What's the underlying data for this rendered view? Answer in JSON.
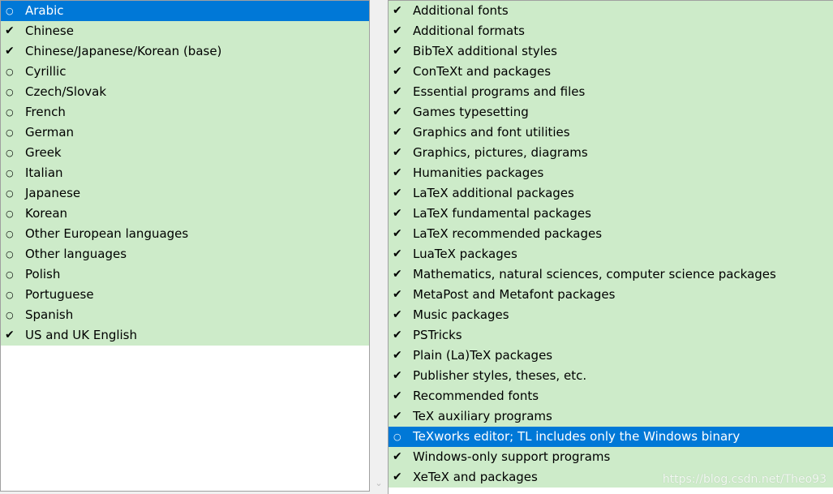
{
  "glyphs": {
    "checked": "✔",
    "unchecked": "○"
  },
  "colors": {
    "checked_row": "#cdebc9",
    "selected_row": "#0078d7",
    "selected_text": "#ffffff"
  },
  "left_list": {
    "name": "language-collections",
    "items": [
      {
        "label": "Arabic",
        "checked": false,
        "selected": true
      },
      {
        "label": "Chinese",
        "checked": true,
        "selected": false
      },
      {
        "label": "Chinese/Japanese/Korean (base)",
        "checked": true,
        "selected": false
      },
      {
        "label": "Cyrillic",
        "checked": false,
        "selected": false
      },
      {
        "label": "Czech/Slovak",
        "checked": false,
        "selected": false
      },
      {
        "label": "French",
        "checked": false,
        "selected": false
      },
      {
        "label": "German",
        "checked": false,
        "selected": false
      },
      {
        "label": "Greek",
        "checked": false,
        "selected": false
      },
      {
        "label": "Italian",
        "checked": false,
        "selected": false
      },
      {
        "label": "Japanese",
        "checked": false,
        "selected": false
      },
      {
        "label": "Korean",
        "checked": false,
        "selected": false
      },
      {
        "label": "Other European languages",
        "checked": false,
        "selected": false
      },
      {
        "label": "Other languages",
        "checked": false,
        "selected": false
      },
      {
        "label": "Polish",
        "checked": false,
        "selected": false
      },
      {
        "label": "Portuguese",
        "checked": false,
        "selected": false
      },
      {
        "label": "Spanish",
        "checked": false,
        "selected": false
      },
      {
        "label": "US and UK English",
        "checked": true,
        "selected": false
      }
    ]
  },
  "right_list": {
    "name": "other-collections",
    "items": [
      {
        "label": "Additional fonts",
        "checked": true,
        "selected": false
      },
      {
        "label": "Additional formats",
        "checked": true,
        "selected": false
      },
      {
        "label": "BibTeX additional styles",
        "checked": true,
        "selected": false
      },
      {
        "label": "ConTeXt and packages",
        "checked": true,
        "selected": false
      },
      {
        "label": "Essential programs and files",
        "checked": true,
        "selected": false
      },
      {
        "label": "Games typesetting",
        "checked": true,
        "selected": false
      },
      {
        "label": "Graphics and font utilities",
        "checked": true,
        "selected": false
      },
      {
        "label": "Graphics, pictures, diagrams",
        "checked": true,
        "selected": false
      },
      {
        "label": "Humanities packages",
        "checked": true,
        "selected": false
      },
      {
        "label": "LaTeX additional packages",
        "checked": true,
        "selected": false
      },
      {
        "label": "LaTeX fundamental packages",
        "checked": true,
        "selected": false
      },
      {
        "label": "LaTeX recommended packages",
        "checked": true,
        "selected": false
      },
      {
        "label": "LuaTeX packages",
        "checked": true,
        "selected": false
      },
      {
        "label": "Mathematics, natural sciences, computer science packages",
        "checked": true,
        "selected": false
      },
      {
        "label": "MetaPost and Metafont packages",
        "checked": true,
        "selected": false
      },
      {
        "label": "Music packages",
        "checked": true,
        "selected": false
      },
      {
        "label": "PSTricks",
        "checked": true,
        "selected": false
      },
      {
        "label": "Plain (La)TeX packages",
        "checked": true,
        "selected": false
      },
      {
        "label": "Publisher styles, theses, etc.",
        "checked": true,
        "selected": false
      },
      {
        "label": "Recommended fonts",
        "checked": true,
        "selected": false
      },
      {
        "label": "TeX auxiliary programs",
        "checked": true,
        "selected": false
      },
      {
        "label": "TeXworks editor; TL includes only the Windows binary",
        "checked": false,
        "selected": true
      },
      {
        "label": "Windows-only support programs",
        "checked": true,
        "selected": false
      },
      {
        "label": "XeTeX and packages",
        "checked": true,
        "selected": false
      }
    ]
  },
  "scroll_arrow_icon": "chevron-down-icon",
  "scroll_arrow_glyph": "⌄",
  "watermark": "https://blog.csdn.net/Theo93"
}
